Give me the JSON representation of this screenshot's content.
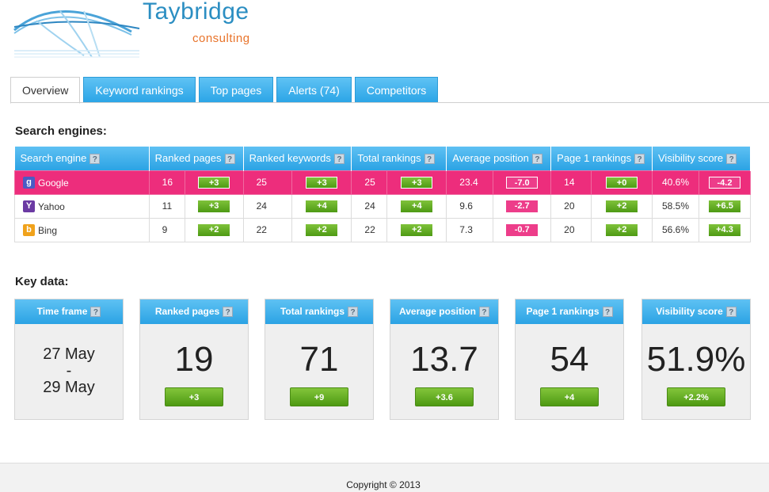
{
  "brand": {
    "title": "Taybridge",
    "subtitle": "consulting"
  },
  "tabs": [
    {
      "label": "Overview",
      "active": true
    },
    {
      "label": "Keyword rankings"
    },
    {
      "label": "Top pages"
    },
    {
      "label": "Alerts (74)"
    },
    {
      "label": "Competitors"
    }
  ],
  "search_engines": {
    "title": "Search engines:",
    "columns": [
      "Search engine",
      "Ranked pages",
      "Ranked keywords",
      "Total rankings",
      "Average position",
      "Page 1 rankings",
      "Visibility score"
    ],
    "help_glyph": "?",
    "rows": [
      {
        "engine": "Google",
        "icon": "google-icon",
        "icon_glyph": "g",
        "highlight": true,
        "ranked_pages": "16",
        "ranked_pages_chg": "+3",
        "ranked_keywords": "25",
        "ranked_keywords_chg": "+3",
        "total_rankings": "25",
        "total_rankings_chg": "+3",
        "avg_position": "23.4",
        "avg_position_chg": "-7.0",
        "page1": "14",
        "page1_chg": "+0",
        "visibility": "40.6%",
        "visibility_chg": "-4.2"
      },
      {
        "engine": "Yahoo",
        "icon": "yahoo-icon",
        "icon_glyph": "Y",
        "ranked_pages": "11",
        "ranked_pages_chg": "+3",
        "ranked_keywords": "24",
        "ranked_keywords_chg": "+4",
        "total_rankings": "24",
        "total_rankings_chg": "+4",
        "avg_position": "9.6",
        "avg_position_chg": "-2.7",
        "page1": "20",
        "page1_chg": "+2",
        "visibility": "58.5%",
        "visibility_chg": "+6.5"
      },
      {
        "engine": "Bing",
        "icon": "bing-icon",
        "icon_glyph": "b",
        "ranked_pages": "9",
        "ranked_pages_chg": "+2",
        "ranked_keywords": "22",
        "ranked_keywords_chg": "+2",
        "total_rankings": "22",
        "total_rankings_chg": "+2",
        "avg_position": "7.3",
        "avg_position_chg": "-0.7",
        "page1": "20",
        "page1_chg": "+2",
        "visibility": "56.6%",
        "visibility_chg": "+4.3"
      }
    ]
  },
  "key_data": {
    "title": "Key data:",
    "time_frame": {
      "label": "Time frame",
      "from": "27 May",
      "sep": "-",
      "to": "29 May"
    },
    "cards": [
      {
        "label": "Ranked pages",
        "value": "19",
        "change": "+3"
      },
      {
        "label": "Total rankings",
        "value": "71",
        "change": "+9"
      },
      {
        "label": "Average position",
        "value": "13.7",
        "change": "+3.6"
      },
      {
        "label": "Page 1 rankings",
        "value": "54",
        "change": "+4"
      },
      {
        "label": "Visibility score",
        "value": "51.9%",
        "change": "+2.2%"
      }
    ]
  },
  "footer": {
    "copyright": "Copyright © 2013"
  },
  "colors": {
    "accent_blue": "#2ba3e4",
    "positive_green": "#4e9a14",
    "negative_pink": "#ed2d7c",
    "brand_orange": "#e8732a"
  }
}
